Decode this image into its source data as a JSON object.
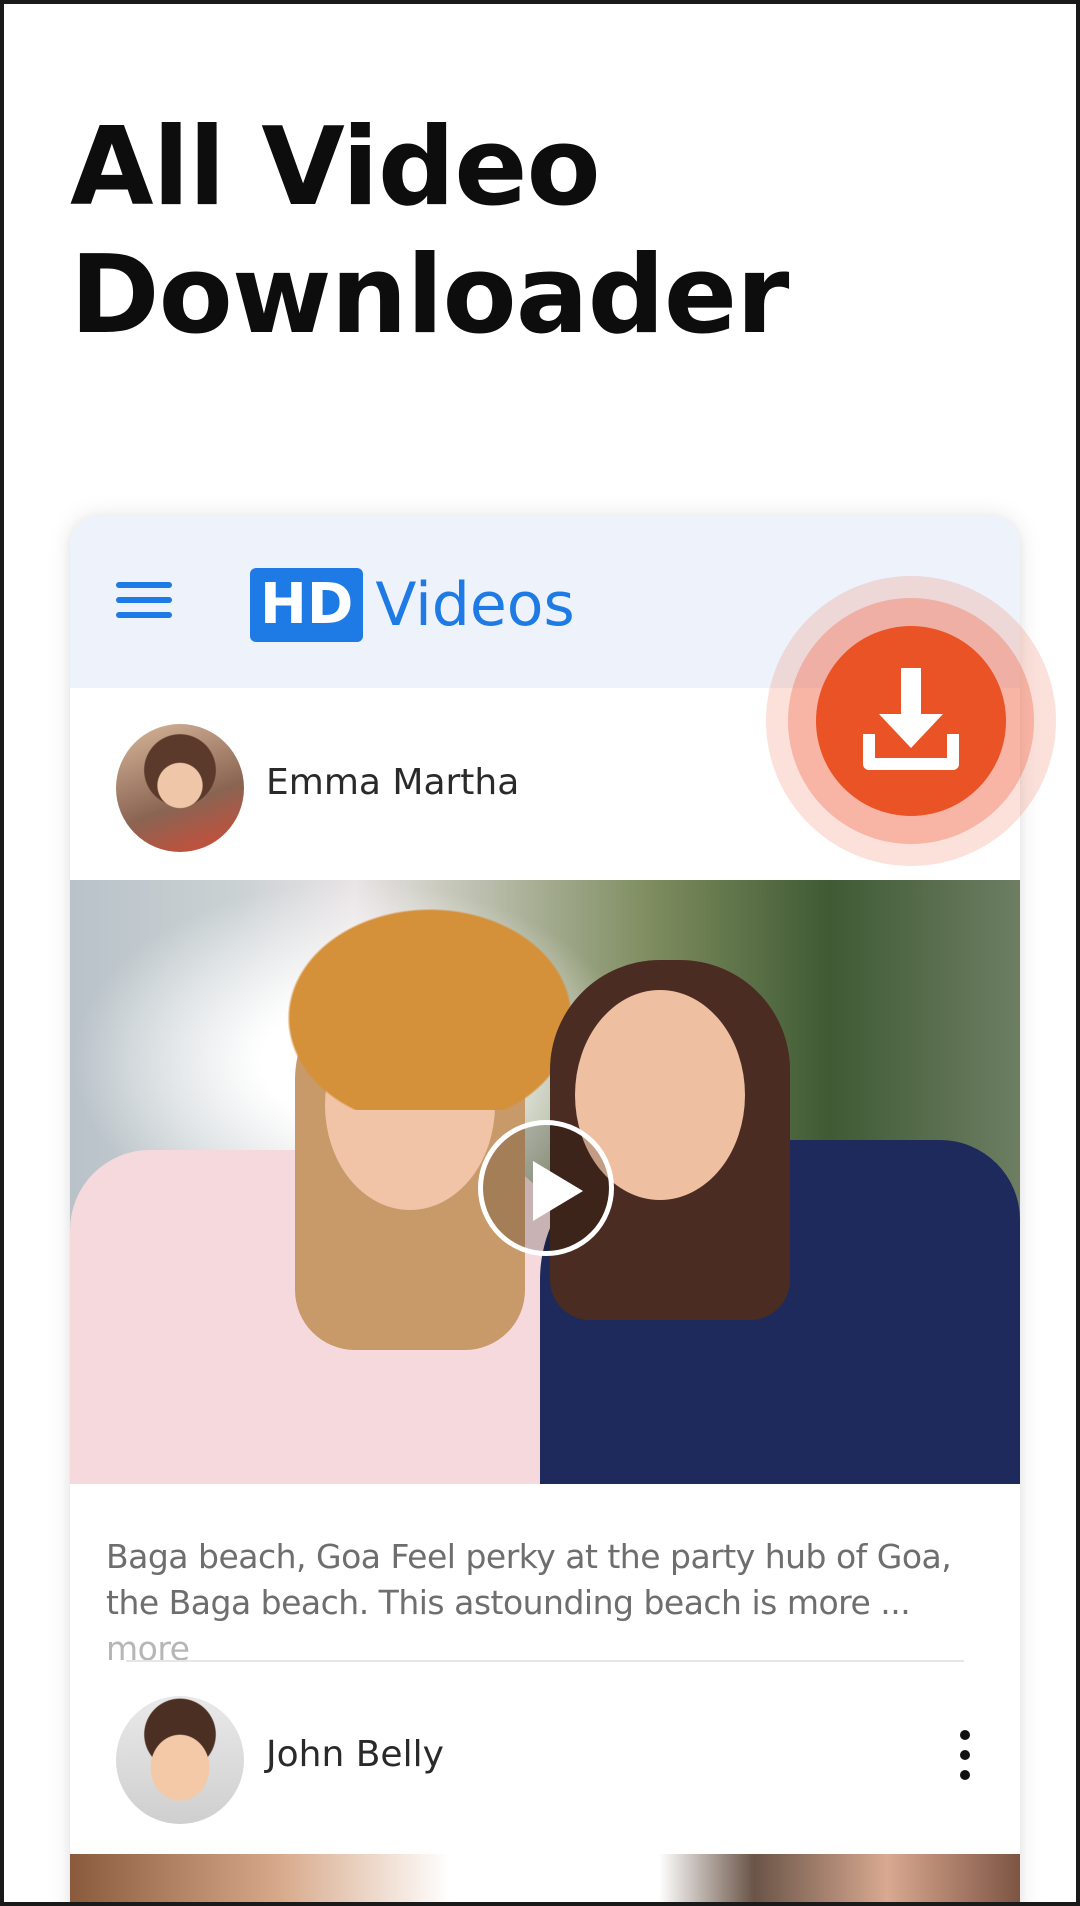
{
  "headline": {
    "line1": "All Video",
    "line2": "Downloader"
  },
  "app_bar": {
    "brand_badge": "HD",
    "brand_text": "Videos",
    "menu_icon": "hamburger-menu-icon",
    "accent_color": "#1e7be6"
  },
  "posts": [
    {
      "author": "Emma Martha",
      "caption": "Baga beach, Goa Feel perky at the party hub of Goa, the Baga beach. This astounding beach is more ...",
      "more_label": "more",
      "media": "video"
    },
    {
      "author": "John Belly",
      "menu_icon": "more-vertical-icon"
    }
  ],
  "fab": {
    "icon": "download-icon",
    "color": "#ea5326"
  }
}
